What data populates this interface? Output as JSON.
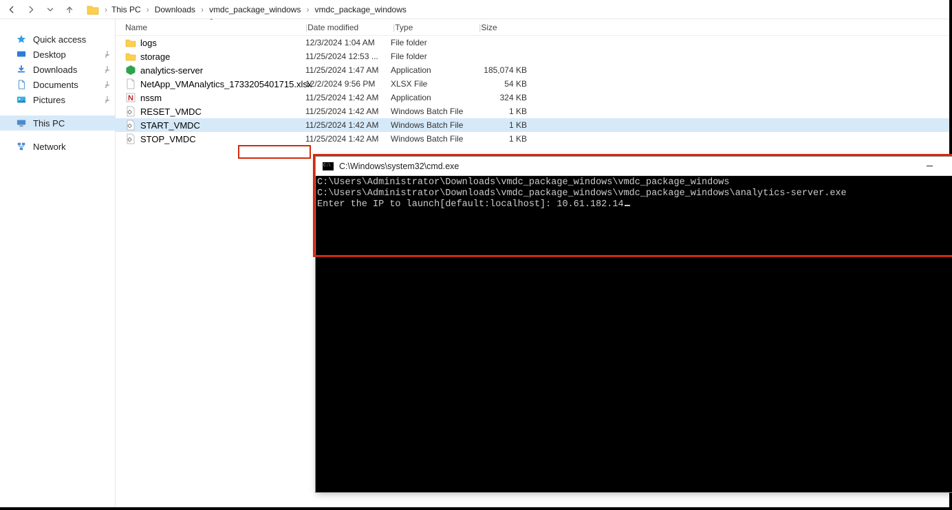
{
  "breadcrumb": {
    "parts": [
      "This PC",
      "Downloads",
      "vmdc_package_windows",
      "vmdc_package_windows"
    ]
  },
  "sidebar": {
    "quick_access": "Quick access",
    "desktop": "Desktop",
    "downloads": "Downloads",
    "documents": "Documents",
    "pictures": "Pictures",
    "this_pc": "This PC",
    "network": "Network"
  },
  "columns": {
    "name": "Name",
    "date": "Date modified",
    "type": "Type",
    "size": "Size"
  },
  "files": [
    {
      "name": "logs",
      "date": "12/3/2024 1:04 AM",
      "type": "File folder",
      "size": "",
      "icon": "folder"
    },
    {
      "name": "storage",
      "date": "11/25/2024 12:53 ...",
      "type": "File folder",
      "size": "",
      "icon": "folder"
    },
    {
      "name": "analytics-server",
      "date": "11/25/2024 1:47 AM",
      "type": "Application",
      "size": "185,074 KB",
      "icon": "app-green"
    },
    {
      "name": "NetApp_VMAnalytics_1733205401715.xlsx",
      "date": "12/2/2024 9:56 PM",
      "type": "XLSX File",
      "size": "54 KB",
      "icon": "file"
    },
    {
      "name": "nssm",
      "date": "11/25/2024 1:42 AM",
      "type": "Application",
      "size": "324 KB",
      "icon": "app-red"
    },
    {
      "name": "RESET_VMDC",
      "date": "11/25/2024 1:42 AM",
      "type": "Windows Batch File",
      "size": "1 KB",
      "icon": "batch"
    },
    {
      "name": "START_VMDC",
      "date": "11/25/2024 1:42 AM",
      "type": "Windows Batch File",
      "size": "1 KB",
      "icon": "batch",
      "selected": true
    },
    {
      "name": "STOP_VMDC",
      "date": "11/25/2024 1:42 AM",
      "type": "Windows Batch File",
      "size": "1 KB",
      "icon": "batch"
    }
  ],
  "cmd": {
    "title": "C:\\Windows\\system32\\cmd.exe",
    "lines": [
      "C:\\Users\\Administrator\\Downloads\\vmdc_package_windows\\vmdc_package_windows",
      "C:\\Users\\Administrator\\Downloads\\vmdc_package_windows\\vmdc_package_windows\\analytics-server.exe",
      "Enter the IP to launch[default:localhost]: 10.61.182.14"
    ]
  }
}
